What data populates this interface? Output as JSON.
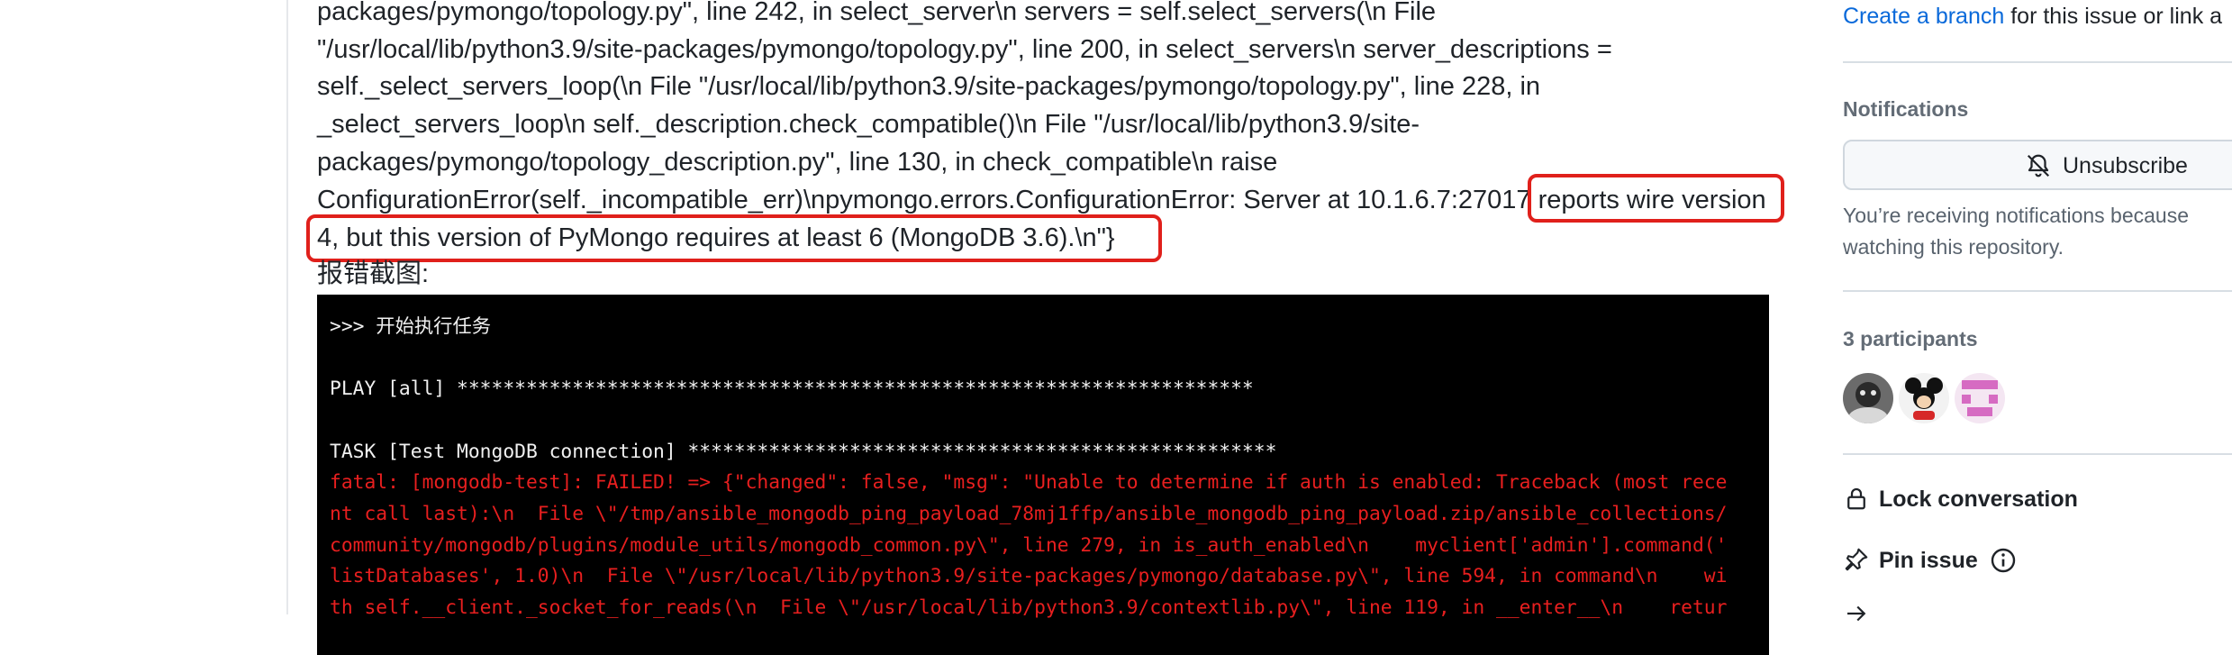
{
  "issue_body": {
    "lines": [
      "packages/pymongo/topology.py\", line 242, in select_server\\n servers = self.select_servers(\\n File",
      "\"/usr/local/lib/python3.9/site-packages/pymongo/topology.py\", line 200, in select_servers\\n server_descriptions =",
      "self._select_servers_loop(\\n File \"/usr/local/lib/python3.9/site-packages/pymongo/topology.py\", line 228, in",
      "_select_servers_loop\\n self._description.check_compatible()\\n File \"/usr/local/lib/python3.9/site-",
      "packages/pymongo/topology_description.py\", line 130, in check_compatible\\n raise",
      "ConfigurationError(self._incompatible_err)\\npymongo.errors.ConfigurationError: Server at 10.1.6.7:27017 reports wire version",
      "4, but this version of PyMongo requires at least 6 (MongoDB 3.6).\\n\"}"
    ],
    "screenshot_caption": "报错截图:"
  },
  "terminal": {
    "lines": [
      {
        "text": ">>> 开始执行任务",
        "color": "white"
      },
      {
        "text": "",
        "color": "white"
      },
      {
        "text": "PLAY [all] *********************************************************************",
        "color": "white"
      },
      {
        "text": "",
        "color": "white"
      },
      {
        "text": "TASK [Test MongoDB connection] ***************************************************",
        "color": "white"
      },
      {
        "text": "fatal: [mongodb-test]: FAILED! => {\"changed\": false, \"msg\": \"Unable to determine if auth is enabled: Traceback (most rece",
        "color": "red"
      },
      {
        "text": "nt call last):\\n  File \\\"/tmp/ansible_mongodb_ping_payload_78mj1ffp/ansible_mongodb_ping_payload.zip/ansible_collections/",
        "color": "red"
      },
      {
        "text": "community/mongodb/plugins/module_utils/mongodb_common.py\\\", line 279, in is_auth_enabled\\n    myclient['admin'].command('",
        "color": "red"
      },
      {
        "text": "listDatabases', 1.0)\\n  File \\\"/usr/local/lib/python3.9/site-packages/pymongo/database.py\\\", line 594, in command\\n    wi",
        "color": "red"
      },
      {
        "text": "th self.__client._socket_for_reads(\\n  File \\\"/usr/local/lib/python3.9/contextlib.py\\\", line 119, in __enter__\\n    retur",
        "color": "red"
      }
    ]
  },
  "sidebar": {
    "create_branch_link": "Create a branch",
    "create_branch_suffix": " for this issue or link a",
    "notifications_heading": "Notifications",
    "unsubscribe_label": "Unsubscribe",
    "notice_line1": "You’re receiving notifications because",
    "notice_line2": "watching this repository.",
    "participants_heading": "3 participants",
    "lock_label": "Lock conversation",
    "pin_label": "Pin issue"
  },
  "colors": {
    "highlight": "#e0201b",
    "link": "#0969da",
    "terminal_bg": "#000000",
    "terminal_error": "#e81f1f"
  },
  "icons": [
    "bell-slash-icon",
    "lock-icon",
    "pin-icon",
    "info-icon"
  ]
}
